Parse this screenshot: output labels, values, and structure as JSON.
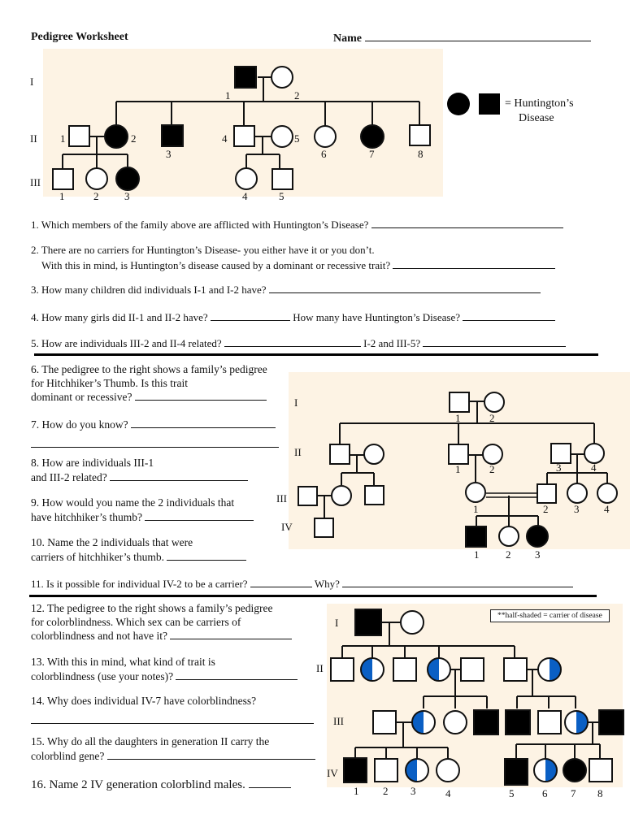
{
  "header": {
    "title": "Pedigree Worksheet",
    "name_label": "Name"
  },
  "pedigree1": {
    "trait": "Huntington's Disease",
    "legend_text_line1": "= Huntington’s",
    "legend_text_line2": "Disease",
    "generation_labels": [
      "I",
      "II",
      "III"
    ],
    "gen1_numbers": [
      "1",
      "2"
    ],
    "gen2_numbers": [
      "1",
      "2",
      "3",
      "4",
      "5",
      "6",
      "7",
      "8"
    ],
    "gen3_numbers": [
      "1",
      "2",
      "3",
      "4",
      "5"
    ],
    "affected_individuals": [
      "I-1",
      "II-2",
      "II-3",
      "II-7",
      "III-3"
    ]
  },
  "questions_part1": [
    {
      "number": "1.",
      "text": "Which members of the family above are afflicted with Huntington’s Disease?"
    },
    {
      "number": "2.",
      "text": "There are no carriers for Huntington’s Disease- you either have it or you don’t.",
      "text2": "With this in mind, is Huntington’s disease caused by a dominant or recessive trait?"
    },
    {
      "number": "3.",
      "text": "How many children did individuals I-1 and I-2 have?"
    },
    {
      "number": "4.",
      "text": "How many girls did II-1 and II-2 have?",
      "text2": "How many have Huntington’s Disease?"
    },
    {
      "number": "5.",
      "text": "How are individuals III-2 and II-4 related?",
      "text2": "I-2 and III-5?"
    }
  ],
  "pedigree2": {
    "trait": "Hitchhiker's Thumb",
    "generation_labels": [
      "I",
      "II",
      "III",
      "IV"
    ],
    "gen1_numbers": [
      "1",
      "2"
    ],
    "gen2_numbers": [
      "1",
      "2",
      "3",
      "4"
    ],
    "gen3_numbers": [
      "1",
      "2",
      "3",
      "4"
    ],
    "gen4_numbers": [
      "1",
      "2",
      "3"
    ],
    "affected_individuals": [
      "IV-1",
      "IV-3"
    ]
  },
  "questions_part2": [
    {
      "number": "6.",
      "lines": [
        "The pedigree to the right shows a family’s pedigree",
        "for Hitchhiker’s Thumb.  Is this trait",
        "dominant or recessive?"
      ]
    },
    {
      "number": "7.",
      "lines": [
        "How do you know?"
      ]
    },
    {
      "number": "8.",
      "lines": [
        "How are individuals III-1",
        "and III-2 related?"
      ]
    },
    {
      "number": "9.",
      "lines": [
        "How would you name the 2 individuals that",
        "have hitchhiker’s thumb?"
      ]
    },
    {
      "number": "10.",
      "lines": [
        "Name the 2 individuals that were",
        "carriers of hitchhiker’s thumb."
      ]
    },
    {
      "number": "11.",
      "lines": [
        "Is it possible for individual IV-2 to be a carrier?"
      ],
      "text2": "Why?"
    }
  ],
  "pedigree3": {
    "trait": "colorblindness",
    "legend_note": "**half-shaded = carrier of disease",
    "generation_labels": [
      "I",
      "II",
      "III",
      "IV"
    ],
    "gen4_numbers": [
      "1",
      "2",
      "3",
      "4",
      "5",
      "6",
      "7",
      "8"
    ],
    "colors": {
      "affected": "#000000",
      "carrier": "#0a5fc4",
      "panel": "#fdf3e4"
    }
  },
  "questions_part3": [
    {
      "number": "12.",
      "lines": [
        "The pedigree to the right shows a family’s pedigree",
        "for colorblindness.  Which sex can be carriers of",
        "colorblindness and not have it?"
      ]
    },
    {
      "number": "13.",
      "lines": [
        "With this in mind, what kind of trait is",
        "colorblindness (use your notes)?"
      ]
    },
    {
      "number": "14.",
      "lines": [
        "Why does individual IV-7 have colorblindness?"
      ]
    },
    {
      "number": "15.",
      "lines": [
        "Why do all the daughters in generation II carry the",
        "colorblind gene?"
      ]
    },
    {
      "number": "16.",
      "lines": [
        "Name 2 IV generation colorblind males."
      ]
    }
  ]
}
